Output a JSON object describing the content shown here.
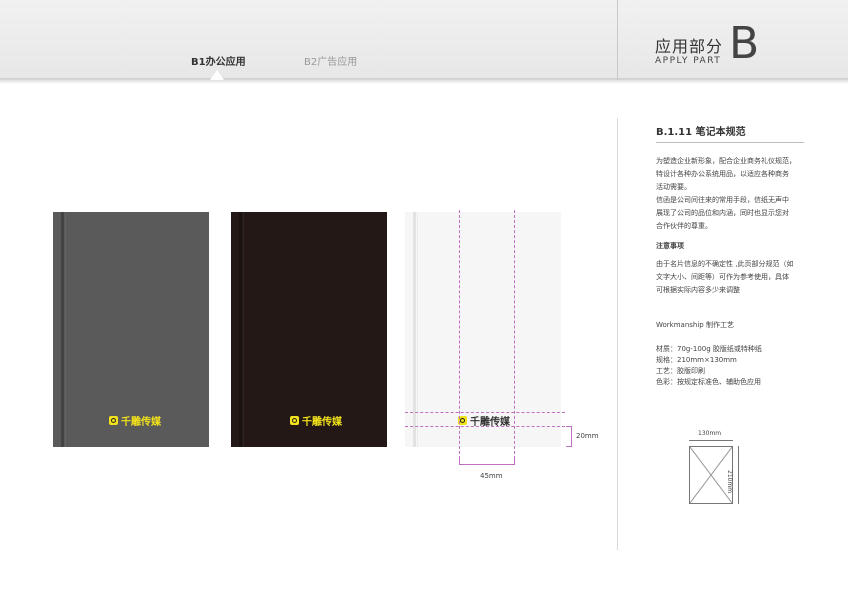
{
  "header": {
    "tab_active": "B1办公应用",
    "tab_inactive": "B2广告应用",
    "section_title": "应用部分",
    "section_sub": "APPLY  PART",
    "section_letter": "B"
  },
  "info": {
    "title": "B.1.11  笔记本规范",
    "body": [
      "为塑造企业新形象，配合企业商务礼仪规范，",
      "特设计各种办公系统用品，以适应各种商务",
      "活动需要。",
      "信函是公司间往来的常用手段，信纸无声中",
      "展现了公司的品位和内涵，同时也显示您对",
      "合作伙伴的尊重。"
    ],
    "notes_heading": "注意事项",
    "notes": [
      "由于名片信息的不确定性 ,此页部分规范（如",
      "文字大小、间距等）可作为参考使用，具体",
      "可根据实际内容多少来调整"
    ],
    "work_heading": "Workmanship  制作工艺",
    "specs": [
      "材质：70g-100g 胶版纸或特种纸",
      "规格：210mm×130mm",
      "工艺：胶版印刷",
      "色彩：按规定标准色、辅助色应用"
    ]
  },
  "notebooks": {
    "logo_text": "千雕传媒",
    "width_dim": "45mm",
    "height_dim": "20mm"
  },
  "spec_drawing": {
    "width_label": "130mm",
    "height_label": "210mm"
  }
}
